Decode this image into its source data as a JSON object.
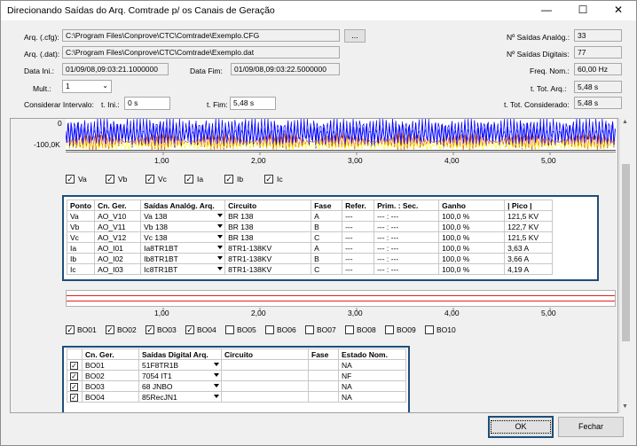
{
  "window": {
    "title": "Direcionando Saídas do Arq. Comtrade p/ os Canais de Geração",
    "minimize": "—",
    "maximize": "☐",
    "close": "✕"
  },
  "top": {
    "cfg_label": "Arq. (.cfg):",
    "cfg_value": "C:\\Program Files\\Conprove\\CTC\\Comtrade\\Exemplo.CFG",
    "browse_label": "...",
    "dat_label": "Arq. (.dat):",
    "dat_value": "C:\\Program Files\\Conprove\\CTC\\Comtrade\\Exemplo.dat",
    "data_ini_label": "Data Ini.:",
    "data_ini_value": "01/09/08,09:03:21.1000000",
    "data_fim_label": "Data Fim:",
    "data_fim_value": "01/09/08,09:03:22.5000000",
    "mult_label": "Mult.:",
    "mult_value": "1",
    "considerar_label": "Considerar Intervalo:",
    "t_ini_label": "t. Ini.:",
    "t_ini_value": "0 s",
    "t_fim_label": "t. Fim:",
    "t_fim_value": "5,48 s",
    "n_analog_label": "Nº Saídas Analóg.:",
    "n_analog_value": "33",
    "n_digital_label": "Nº Saídas Digitais:",
    "n_digital_value": "77",
    "freq_label": "Freq. Nom.:",
    "freq_value": "60,00 Hz",
    "t_tot_arq_label": "t. Tot. Arq.:",
    "t_tot_arq_value": "5,48 s",
    "t_tot_cons_label": "t. Tot. Considerado:",
    "t_tot_cons_value": "5,48 s"
  },
  "chart": {
    "y_top": "0",
    "y_bottom": "-100,0K",
    "x_ticks": [
      "1,00",
      "2,00",
      "3,00",
      "4,00",
      "5,00"
    ],
    "colors": {
      "series_a": "#0000ff",
      "series_b": "#e06000",
      "series_c": "#ffff00"
    }
  },
  "analog_checks": [
    {
      "label": "Va",
      "checked": "✓"
    },
    {
      "label": "Vb",
      "checked": "✓"
    },
    {
      "label": "Vc",
      "checked": "✓"
    },
    {
      "label": "Ia",
      "checked": "✓"
    },
    {
      "label": "Ib",
      "checked": "✓"
    },
    {
      "label": "Ic",
      "checked": "✓"
    }
  ],
  "analog_table": {
    "headers": [
      "Ponto",
      "Cn. Ger.",
      "Saídas Analóg. Arq.",
      "Circuito",
      "Fase",
      "Refer.",
      "Prim. : Sec.",
      "Ganho",
      "| Pico |"
    ],
    "rows": [
      [
        "Va",
        "AO_V10",
        "Va 138",
        "BR 138",
        "A",
        "---",
        "--- : ---",
        "100,0 %",
        "121,5 KV"
      ],
      [
        "Vb",
        "AO_V11",
        "Vb 138",
        "BR 138",
        "B",
        "---",
        "--- : ---",
        "100,0 %",
        "122,7 KV"
      ],
      [
        "Vc",
        "AO_V12",
        "Vc 138",
        "BR 138",
        "C",
        "---",
        "--- : ---",
        "100,0 %",
        "121,5 KV"
      ],
      [
        "Ia",
        "AO_I01",
        "Ia8TR1BT",
        "8TR1-138KV",
        "A",
        "---",
        "--- : ---",
        "100,0 %",
        "3,63 A"
      ],
      [
        "Ib",
        "AO_I02",
        "Ib8TR1BT",
        "8TR1-138KV",
        "B",
        "---",
        "--- : ---",
        "100,0 %",
        "3,66 A"
      ],
      [
        "Ic",
        "AO_I03",
        "Ic8TR1BT",
        "8TR1-138KV",
        "C",
        "---",
        "--- : ---",
        "100,0 %",
        "4,19 A"
      ]
    ]
  },
  "digital_x_ticks": [
    "1,00",
    "2,00",
    "3,00",
    "4,00",
    "5,00"
  ],
  "bo_checks": [
    {
      "label": "BO01",
      "checked": "✓"
    },
    {
      "label": "BO02",
      "checked": "✓"
    },
    {
      "label": "BO03",
      "checked": "✓"
    },
    {
      "label": "BO04",
      "checked": "✓"
    },
    {
      "label": "BO05",
      "checked": ""
    },
    {
      "label": "BO06",
      "checked": ""
    },
    {
      "label": "BO07",
      "checked": ""
    },
    {
      "label": "BO08",
      "checked": ""
    },
    {
      "label": "BO09",
      "checked": ""
    },
    {
      "label": "BO10",
      "checked": ""
    }
  ],
  "digital_table": {
    "headers": [
      "",
      "Cn. Ger.",
      "Saídas Digital Arq.",
      "Circuito",
      "Fase",
      "Estado Nom."
    ],
    "rows": [
      [
        "✓",
        "BO01",
        "51F8TR1B",
        "",
        "",
        "NA"
      ],
      [
        "✓",
        "BO02",
        "7054 IT1",
        "",
        "",
        "NF"
      ],
      [
        "✓",
        "BO03",
        "68 JNBO",
        "",
        "",
        "NA"
      ],
      [
        "✓",
        "BO04",
        "85RecJN1",
        "",
        "",
        "NA"
      ]
    ]
  },
  "footer": {
    "ok": "OK",
    "fechar": "Fechar"
  }
}
